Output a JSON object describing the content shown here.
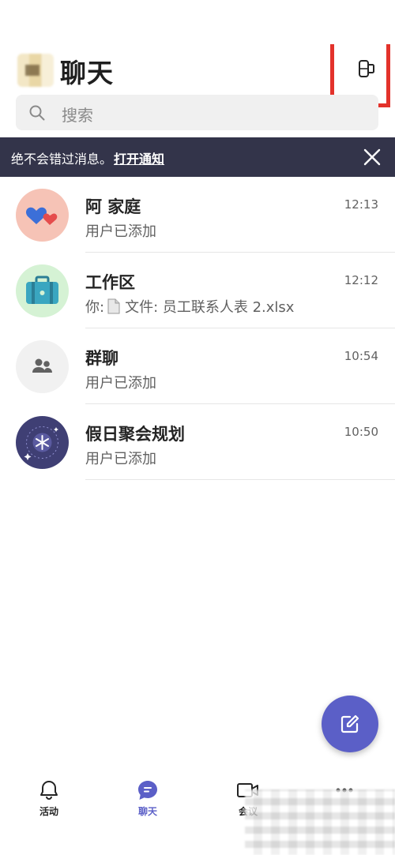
{
  "header": {
    "title": "聊天"
  },
  "search": {
    "placeholder": "搜索"
  },
  "banner": {
    "message": "绝不会错过消息。",
    "link": "打开通知"
  },
  "chats": [
    {
      "name": "阿 家庭",
      "time": "12:13",
      "preview": "用户已添加",
      "avatar": "hearts-avatar",
      "avatar_color": "#f6c3b6"
    },
    {
      "name": "工作区",
      "time": "12:12",
      "preview_prefix": "你:",
      "preview": "文件: 员工联系人表 2.xlsx",
      "avatar": "suitcase-avatar",
      "avatar_color": "#d5f2d4"
    },
    {
      "name": "群聊",
      "time": "10:54",
      "preview": "用户已添加",
      "avatar": "people-avatar",
      "avatar_color": "#f1f1f1"
    },
    {
      "name": "假日聚会规划",
      "time": "10:50",
      "preview": "用户已添加",
      "avatar": "snowflake-avatar",
      "avatar_color": "#3f3f74"
    }
  ],
  "tabs": [
    {
      "label": "活动",
      "icon": "bell-icon",
      "active": false
    },
    {
      "label": "聊天",
      "icon": "chat-bubble-icon",
      "active": true
    },
    {
      "label": "会议",
      "icon": "video-camera-icon",
      "active": false
    },
    {
      "label": "",
      "icon": "more-icon",
      "active": false
    }
  ],
  "colors": {
    "accent": "#5b5fc7",
    "banner_bg": "#33344a",
    "highlight_box": "#e3322b"
  }
}
